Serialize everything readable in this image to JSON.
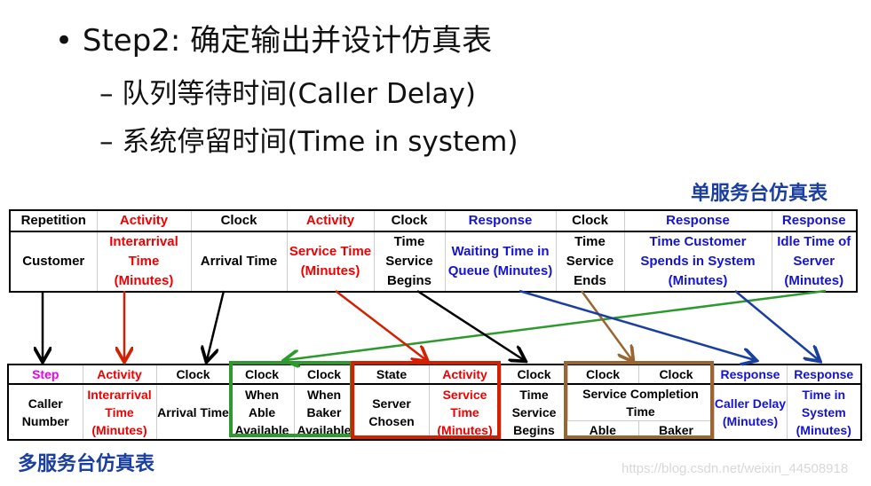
{
  "heading": {
    "bullet": "•",
    "title": "Step2: 确定输出并设计仿真表",
    "sub1": "– 队列等待时间(Caller Delay)",
    "sub2": "– 系统停留时间(Time in system)"
  },
  "single_label": "单服务台仿真表",
  "multi_label": "多服务台仿真表",
  "single_table": {
    "headers": [
      "Repetition",
      "Activity",
      "Clock",
      "Activity",
      "Clock",
      "Response",
      "Clock",
      "Response",
      "Response"
    ],
    "body": [
      "Customer",
      "Interarrival Time (Minutes)",
      "Arrival Time",
      "Service Time (Minutes)",
      "Time Service Begins",
      "Waiting Time in Queue (Minutes)",
      "Time Service Ends",
      "Time Customer Spends in System (Minutes)",
      "Idle Time of Server (Minutes)"
    ]
  },
  "multi_table": {
    "headers": [
      "Step",
      "Activity",
      "Clock",
      "Clock",
      "Clock",
      "State",
      "Activity",
      "Clock",
      "Clock",
      "Clock",
      "Response",
      "Response"
    ],
    "body": [
      "Caller Number",
      "Interarrival Time (Minutes)",
      "Arrival Time",
      "When Able Available",
      "When Baker Available",
      "Server Chosen",
      "Service Time (Minutes)",
      "Time Service Begins",
      "Service Completion Time",
      "Caller Delay (Minutes)",
      "Time in System (Minutes)"
    ],
    "sub": [
      "Able",
      "Baker"
    ]
  },
  "colors": {
    "activity": "#ee0000",
    "response": "#1414d0",
    "step": "#ee00ee",
    "green_box": "#2e9a2e",
    "red_box": "#d42000",
    "brown_box": "#9a6530",
    "label": "#1a3fa0"
  },
  "watermark": "https://blog.csdn.net/weixin_44508918"
}
